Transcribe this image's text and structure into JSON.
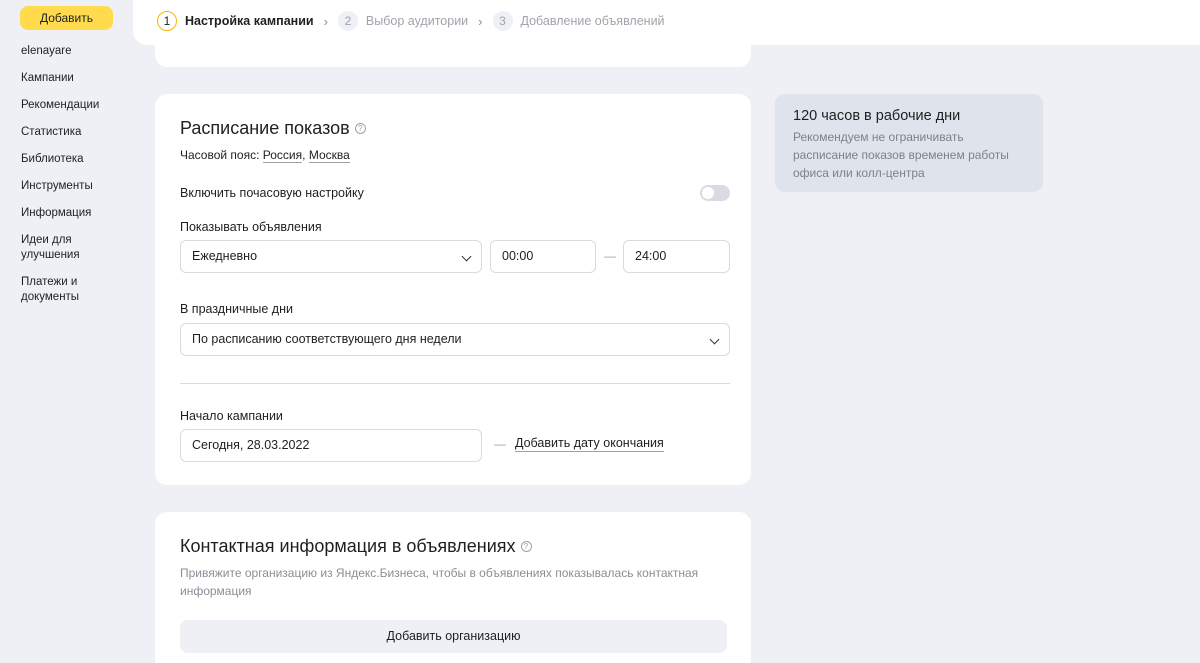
{
  "sidebar": {
    "add_label": "Добавить",
    "items": [
      "elenayare",
      "Кампании",
      "Рекомендации",
      "Статистика",
      "Библиотека",
      "Инструменты",
      "Информация",
      "Идеи для улучшения",
      "Платежи и документы"
    ]
  },
  "stepper": {
    "steps": [
      {
        "num": "1",
        "label": "Настройка кампании"
      },
      {
        "num": "2",
        "label": "Выбор аудитории"
      },
      {
        "num": "3",
        "label": "Добавление объявлений"
      }
    ],
    "active_step": 1
  },
  "schedule": {
    "title": "Расписание показов",
    "timezone_label": "Часовой пояс:",
    "timezone_country": "Россия",
    "timezone_city": "Москва",
    "hourly_toggle_label": "Включить почасовую настройку",
    "hourly_toggle_on": false,
    "show_ads_label": "Показывать объявления",
    "days_value": "Ежедневно",
    "time_from": "00:00",
    "time_dash": "—",
    "time_to": "24:00",
    "holidays_label": "В праздничные дни",
    "holidays_value": "По расписанию соответствующего дня недели",
    "start_label": "Начало кампании",
    "start_value": "Сегодня, 28.03.2022",
    "end_dash": "—",
    "add_end_date": "Добавить дату окончания"
  },
  "contact": {
    "title": "Контактная информация в объявлениях",
    "description": "Привяжите организацию из Яндекс.Бизнеса, чтобы в объявлениях показывалась контактная информация",
    "add_org": "Добавить организацию"
  },
  "tip": {
    "title": "120 часов в рабочие дни",
    "text": "Рекомендуем не ограничивать расписание показов временем работы офиса или колл-центра"
  },
  "colors": {
    "accent": "#ffdb4d",
    "active_step_ring": "#f5b800",
    "background": "#eef0f5"
  }
}
